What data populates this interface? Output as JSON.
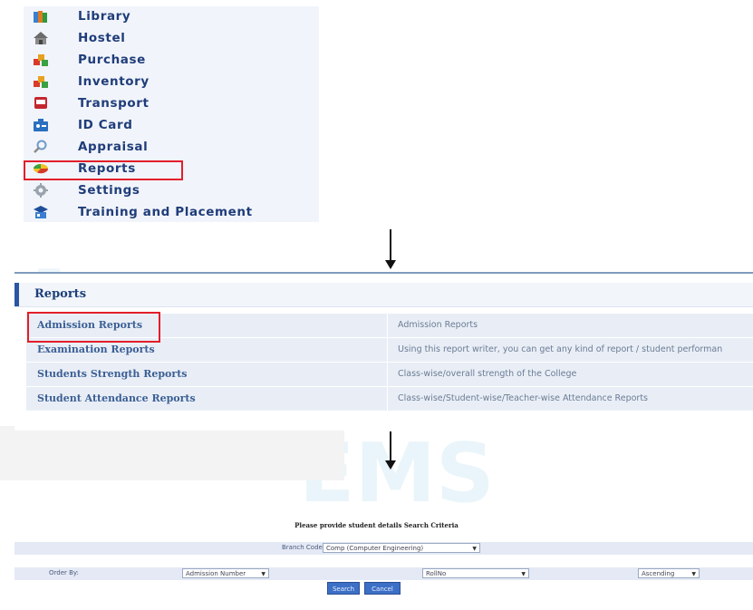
{
  "menu": {
    "items": [
      {
        "label": "Library",
        "icon": "books-icon"
      },
      {
        "label": "Hostel",
        "icon": "house-icon"
      },
      {
        "label": "Purchase",
        "icon": "boxes-icon"
      },
      {
        "label": "Inventory",
        "icon": "boxes-icon"
      },
      {
        "label": "Transport",
        "icon": "bus-icon"
      },
      {
        "label": "ID Card",
        "icon": "id-card-icon"
      },
      {
        "label": "Appraisal",
        "icon": "magnifier-icon"
      },
      {
        "label": "Reports",
        "icon": "pie-chart-icon"
      },
      {
        "label": "Settings",
        "icon": "gear-icon"
      },
      {
        "label": "Training and Placement",
        "icon": "graduation-icon"
      }
    ],
    "selected": "Reports"
  },
  "reports": {
    "title": "Reports",
    "rows": [
      {
        "name": "Admission Reports",
        "description": "Admission Reports"
      },
      {
        "name": "Examination Reports",
        "description": "Using this report writer, you can get any kind of report / student performan"
      },
      {
        "name": "Students Strength Reports",
        "description": "Class-wise/overall strength of the College"
      },
      {
        "name": "Student Attendance Reports",
        "description": "Class-wise/Student-wise/Teacher-wise Attendance Reports"
      }
    ],
    "highlighted": "Admission Reports"
  },
  "search_form": {
    "heading": "Please provide student details Search Criteria",
    "branch_label": "Branch Code",
    "branch_value": "Comp (Computer Engineering)",
    "order_label": "Order By:",
    "order_field": "Admission Number",
    "order_field2": "RollNo",
    "order_direction": "Ascending",
    "search_button": "Search",
    "cancel_button": "Cancel"
  },
  "colors": {
    "highlight": "#e31e2a",
    "menu_text": "#1f3d7a",
    "accent": "#2a56a5",
    "button": "#3c6fc6"
  }
}
